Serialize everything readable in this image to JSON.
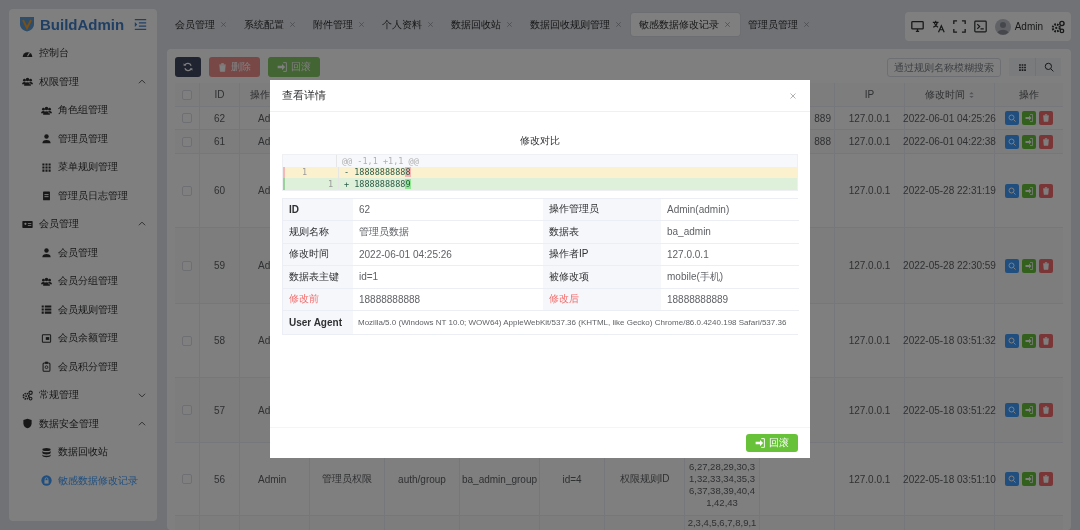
{
  "sidebar": {
    "logo": "BuildAdmin",
    "items": [
      {
        "label": "控制台",
        "selected": false
      },
      {
        "label": "权限管理",
        "selected": false,
        "expanded": true,
        "children": [
          {
            "label": "角色组管理",
            "selected": false
          },
          {
            "label": "管理员管理",
            "selected": false
          },
          {
            "label": "菜单规则管理",
            "selected": false
          },
          {
            "label": "管理员日志管理",
            "selected": false
          }
        ]
      },
      {
        "label": "会员管理",
        "selected": false,
        "expanded": true,
        "children": [
          {
            "label": "会员管理",
            "selected": false
          },
          {
            "label": "会员分组管理",
            "selected": false
          },
          {
            "label": "会员规则管理",
            "selected": false
          },
          {
            "label": "会员余额管理",
            "selected": false
          },
          {
            "label": "会员积分管理",
            "selected": false
          }
        ]
      },
      {
        "label": "常规管理",
        "selected": false,
        "expanded": false
      },
      {
        "label": "数据安全管理",
        "selected": false,
        "expanded": true,
        "children": [
          {
            "label": "数据回收站",
            "selected": false
          },
          {
            "label": "敏感数据修改记录",
            "selected": true
          }
        ]
      }
    ]
  },
  "tabs": [
    {
      "label": "会员管理",
      "selected": false
    },
    {
      "label": "系统配置",
      "selected": false
    },
    {
      "label": "附件管理",
      "selected": false
    },
    {
      "label": "个人资料",
      "selected": false
    },
    {
      "label": "数据回收站",
      "selected": false
    },
    {
      "label": "数据回收规则管理",
      "selected": false
    },
    {
      "label": "敏感数据修改记录",
      "selected": true
    },
    {
      "label": "管理员管理",
      "selected": false
    }
  ],
  "user": "Admin",
  "toolbar": {
    "buttons": [
      {
        "kind": "refresh",
        "disabled": false
      },
      {
        "kind": "delete",
        "label": "删除",
        "disabled": true
      },
      {
        "kind": "rollback",
        "label": "回滚",
        "disabled": true
      }
    ],
    "search": {
      "placeholder": "通过规则名称模糊搜索"
    }
  },
  "table": {
    "select_all_checked": false,
    "headers": {
      "id": "ID",
      "column_3": "操作",
      "ip": "IP",
      "time": "修改时间",
      "actions": "操作"
    },
    "time_sortable": true,
    "rows": [
      {
        "checked": false,
        "id": "62",
        "column_3": "Ad",
        "column_10": "889",
        "ip": "127.0.0.1",
        "time": "2022-06-01 04:25:26",
        "actions": true
      },
      {
        "checked": false,
        "id": "61",
        "column_3": "Ad",
        "column_10": "888",
        "ip": "127.0.0.1",
        "time": "2022-06-01 04:22:38",
        "actions": true
      },
      {
        "checked": false,
        "id": "60",
        "column_3": "Ad",
        "ip": "127.0.0.1",
        "time": "2022-05-28 22:31:19",
        "actions": true
      },
      {
        "checked": false,
        "id": "59",
        "column_3": "Ad",
        "ip": "127.0.0.1",
        "time": "2022-05-28 22:30:59",
        "actions": true
      },
      {
        "checked": false,
        "id": "58",
        "column_3": "Ad",
        "ip": "127.0.0.1",
        "time": "2022-05-18 03:51:32",
        "actions": true
      },
      {
        "checked": false,
        "id": "57",
        "column_3": "Ad",
        "ip": "127.0.0.1",
        "time": "2022-05-18 03:51:22",
        "actions": true
      },
      {
        "checked": false,
        "id": "56",
        "column_3": "Admin",
        "column_4": "管理员权限",
        "column_5": "auth/group",
        "column_6": "ba_admin_group",
        "column_7": "id=4",
        "column_8": "权限规则ID",
        "column_9": "6,27,28,29,30,31,32,33,34,35,36,37,38,39,40,41,42,43",
        "ip": "127.0.0.1",
        "time": "2022-05-18 03:51:10",
        "actions": true
      },
      {
        "column_9": "2,3,4,5,6,7,8,9,1"
      }
    ]
  },
  "modal": {
    "title": "查看详情",
    "diff_title": "修改对比",
    "diff": [
      {
        "kind": "hunk",
        "text": "@@ -1,1 +1,1 @@"
      },
      {
        "kind": "removed",
        "old_line": "1",
        "text": "- 1888888888",
        "changed": "8"
      },
      {
        "kind": "added",
        "new_line": "1",
        "text": "+ 1888888888",
        "changed": "9"
      }
    ],
    "details": [
      [
        {
          "label": "ID",
          "value": "62",
          "emphasis": false
        },
        {
          "label": "操作管理员",
          "value": "Admin(admin)",
          "emphasis": false
        }
      ],
      [
        {
          "label": "规则名称",
          "value": "管理员数据",
          "emphasis": false
        },
        {
          "label": "数据表",
          "value": "ba_admin",
          "emphasis": false
        }
      ],
      [
        {
          "label": "修改时间",
          "value": "2022-06-01 04:25:26",
          "emphasis": false
        },
        {
          "label": "操作者IP",
          "value": "127.0.0.1",
          "emphasis": false
        }
      ],
      [
        {
          "label": "数据表主键",
          "value": "id=1",
          "emphasis": false
        },
        {
          "label": "被修改项",
          "value": "mobile(手机)",
          "emphasis": false
        }
      ],
      [
        {
          "label": "修改前",
          "value": "18888888888",
          "emphasis": true
        },
        {
          "label": "修改后",
          "value": "18888888889",
          "emphasis": true
        }
      ],
      [
        {
          "label": "User Agent",
          "value": "Mozilla/5.0 (Windows NT 10.0; WOW64) AppleWebKit/537.36 (KHTML, like Gecko) Chrome/86.0.4240.198 Safari/537.36",
          "emphasis": false
        }
      ]
    ],
    "button": "回滚"
  }
}
